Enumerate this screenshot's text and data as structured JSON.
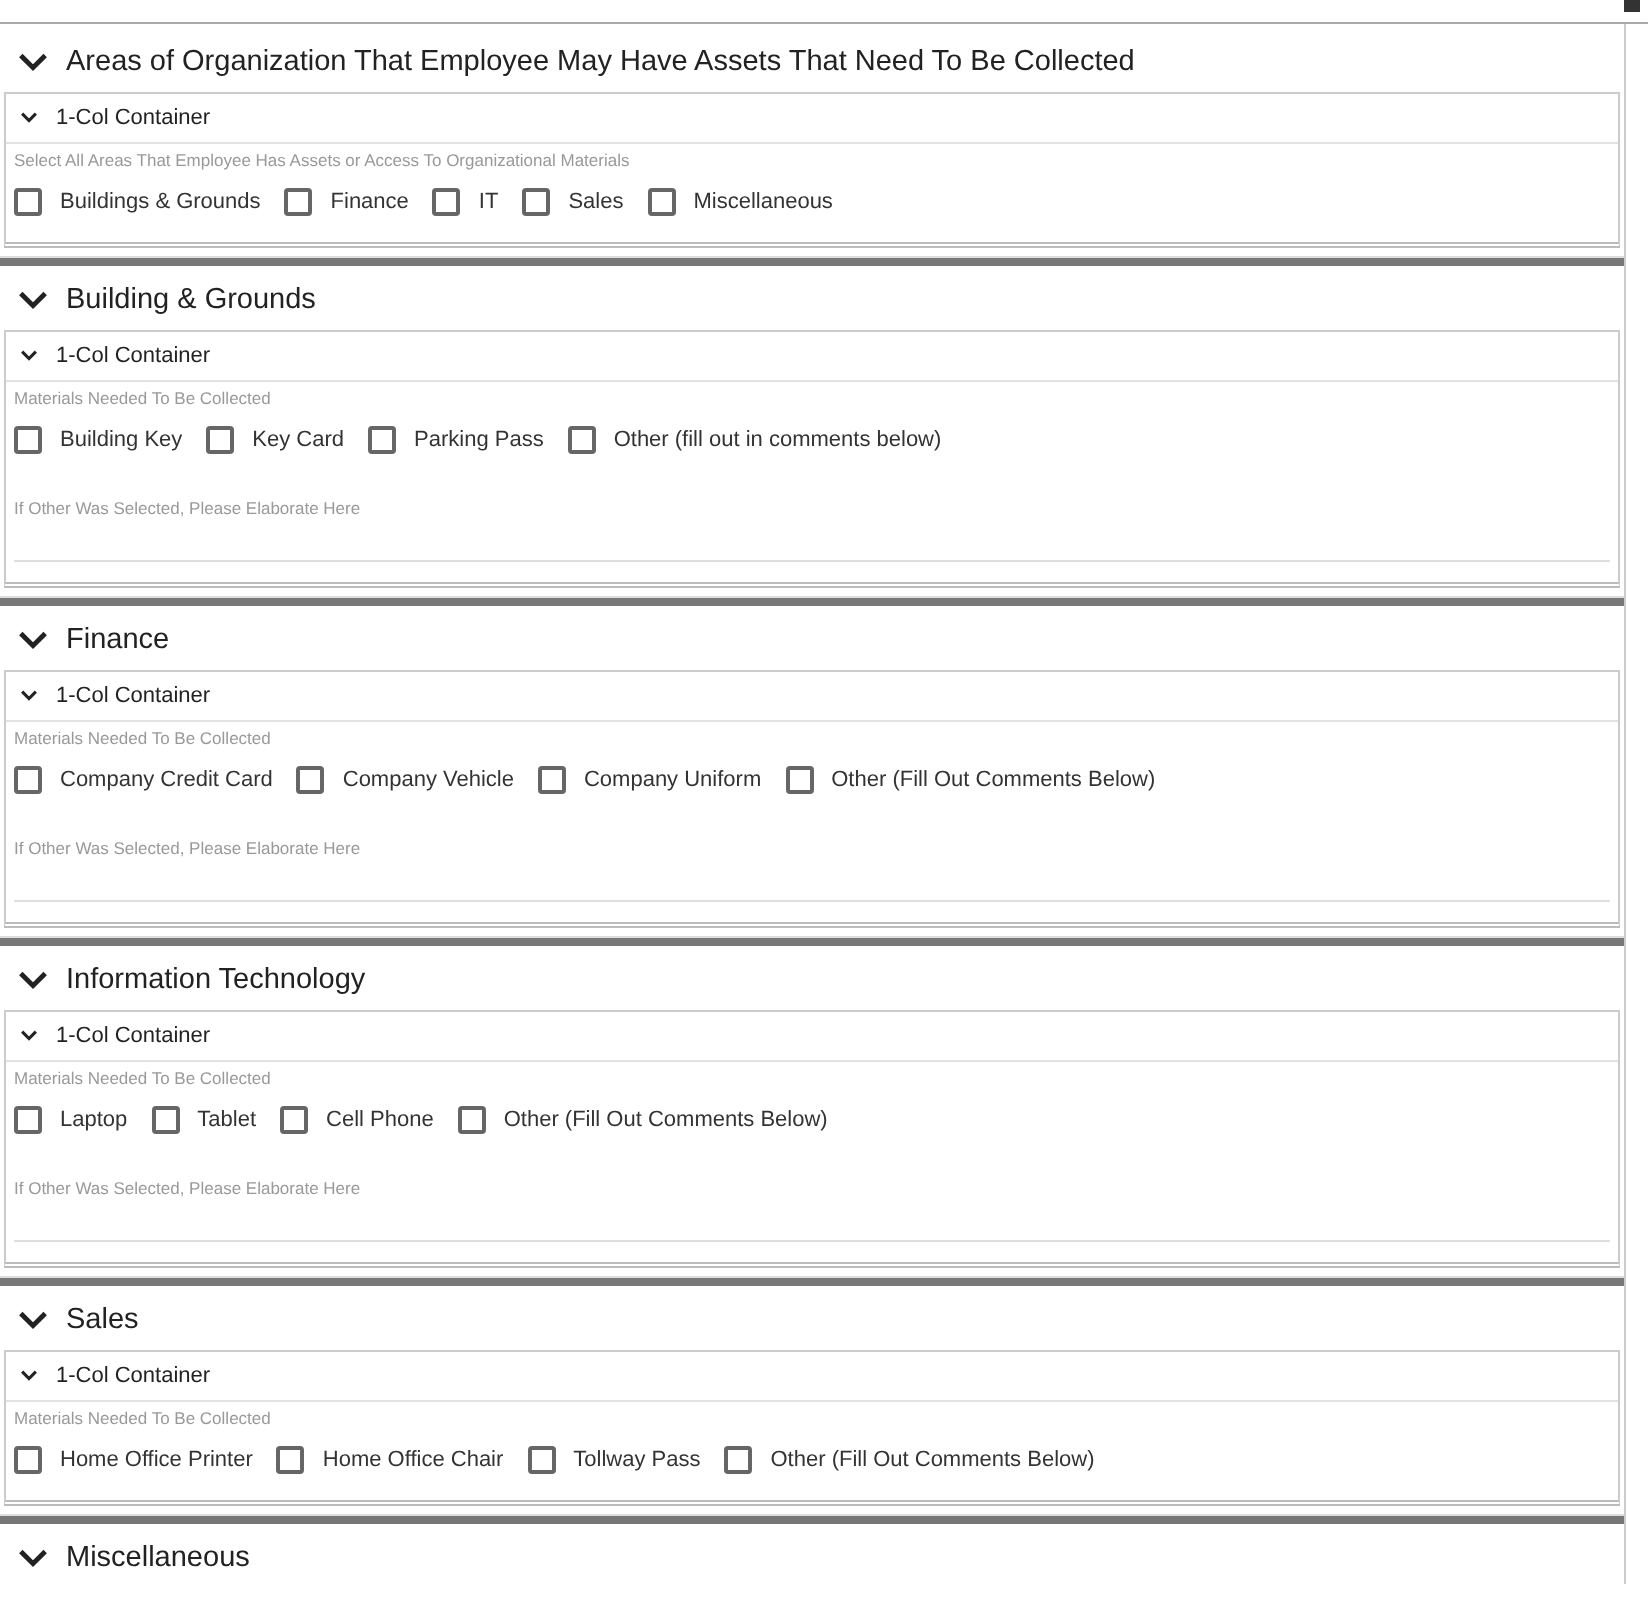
{
  "sections": [
    {
      "title": "Areas of Organization That Employee May Have Assets That Need To Be Collected",
      "expanded": true,
      "container": {
        "title": "1-Col Container",
        "expanded": true,
        "prompt": "Select All Areas That Employee Has Assets or Access To Organizational Materials",
        "options": [
          {
            "label": "Buildings & Grounds",
            "checked": false
          },
          {
            "label": "Finance",
            "checked": false
          },
          {
            "label": "IT",
            "checked": false
          },
          {
            "label": "Sales",
            "checked": false
          },
          {
            "label": "Miscellaneous",
            "checked": false
          }
        ]
      }
    },
    {
      "title": "Building & Grounds",
      "expanded": true,
      "container": {
        "title": "1-Col Container",
        "expanded": true,
        "prompt": "Materials Needed To Be Collected",
        "options": [
          {
            "label": "Building Key",
            "checked": false
          },
          {
            "label": "Key Card",
            "checked": false
          },
          {
            "label": "Parking Pass",
            "checked": false
          },
          {
            "label": "Other (fill out in comments below)",
            "checked": false
          }
        ],
        "comments": {
          "label": "If Other Was Selected, Please Elaborate Here"
        }
      }
    },
    {
      "title": "Finance",
      "expanded": true,
      "container": {
        "title": "1-Col Container",
        "expanded": true,
        "prompt": "Materials Needed To Be Collected",
        "options": [
          {
            "label": "Company Credit Card",
            "checked": false
          },
          {
            "label": "Company Vehicle",
            "checked": false
          },
          {
            "label": "Company Uniform",
            "checked": false
          },
          {
            "label": "Other (Fill Out Comments Below)",
            "checked": false
          }
        ],
        "comments": {
          "label": "If Other Was Selected, Please Elaborate Here"
        }
      }
    },
    {
      "title": "Information Technology",
      "expanded": true,
      "container": {
        "title": "1-Col Container",
        "expanded": true,
        "prompt": "Materials Needed To Be Collected",
        "options": [
          {
            "label": "Laptop",
            "checked": false
          },
          {
            "label": "Tablet",
            "checked": false
          },
          {
            "label": "Cell Phone",
            "checked": false
          },
          {
            "label": "Other (Fill Out Comments Below)",
            "checked": false
          }
        ],
        "comments": {
          "label": "If Other Was Selected, Please Elaborate Here"
        }
      }
    },
    {
      "title": "Sales",
      "expanded": true,
      "container": {
        "title": "1-Col Container",
        "expanded": true,
        "prompt": "Materials Needed To Be Collected",
        "options": [
          {
            "label": "Home Office Printer",
            "checked": false
          },
          {
            "label": "Home Office Chair",
            "checked": false
          },
          {
            "label": "Tollway Pass",
            "checked": false
          },
          {
            "label": "Other (Fill Out Comments Below)",
            "checked": false
          }
        ]
      }
    },
    {
      "title": "Miscellaneous",
      "expanded": true
    }
  ]
}
